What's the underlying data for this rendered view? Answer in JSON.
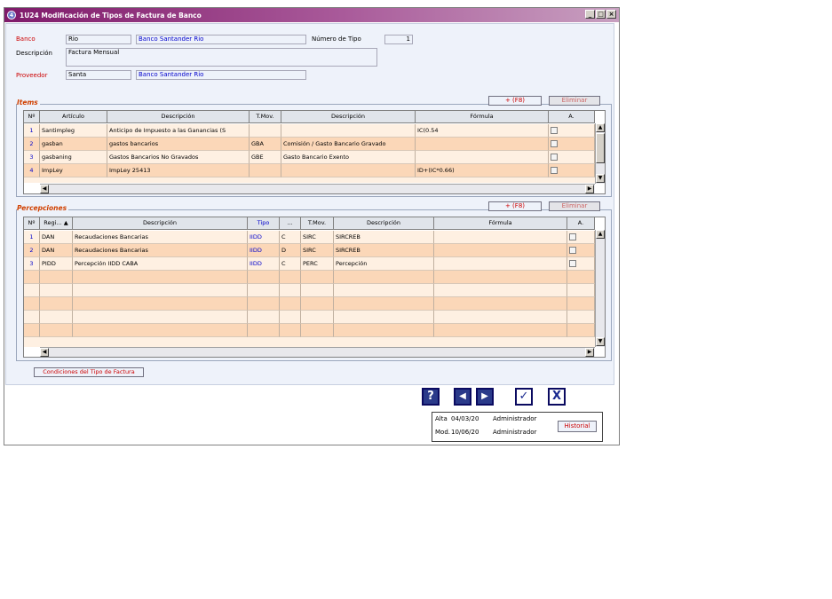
{
  "window": {
    "icon_text": "4",
    "title": "1U24   Modificación de Tipos de Factura de Banco",
    "btn_min": "_",
    "btn_max": "□",
    "btn_close": "×"
  },
  "form": {
    "banco_label": "Banco",
    "banco_code": "Rio",
    "banco_name": "Banco Santander Rio",
    "numero_tipo_label": "Número de Tipo",
    "numero_tipo_value": "1",
    "descripcion_label": "Descripción",
    "descripcion_value": "Factura Mensual",
    "proveedor_label": "Proveedor",
    "proveedor_code": "Santa",
    "proveedor_name": "Banco Santander Rio"
  },
  "items": {
    "section_title": "Items",
    "add_button": "+ (F8)",
    "delete_button": "Eliminar",
    "columns": [
      "Nº",
      "Artículo",
      "Descripción",
      "T.Mov.",
      "Descripción",
      "Fórmula",
      "A."
    ],
    "rows": [
      {
        "n": "1",
        "articulo": "Santimpleg",
        "descripcion": "Anticipo de Impuesto a las Ganancias (S",
        "tmov": "",
        "descripcion2": "",
        "formula": "IC(0.54",
        "checked": false
      },
      {
        "n": "2",
        "articulo": "gasban",
        "descripcion": "gastos bancarios",
        "tmov": "GBA",
        "descripcion2": "Comisión / Gasto Bancario Gravado",
        "formula": "",
        "checked": false
      },
      {
        "n": "3",
        "articulo": "gasbaning",
        "descripcion": "Gastos Bancarios No Gravados",
        "tmov": "GBE",
        "descripcion2": "Gasto Bancario Exento",
        "formula": "",
        "checked": false
      },
      {
        "n": "4",
        "articulo": "ImpLey",
        "descripcion": "ImpLey 25413",
        "tmov": "",
        "descripcion2": "",
        "formula": "ID+(IC*0.66)",
        "checked": false
      }
    ]
  },
  "percepciones": {
    "section_title": "Percepciones",
    "add_button": "+ (F8)",
    "delete_button": "Eliminar",
    "columns": [
      "Nº",
      "Regi... ▲",
      "Descripción",
      "Tipo",
      "...",
      "T.Mov.",
      "Descripción",
      "Fórmula",
      "A."
    ],
    "rows": [
      {
        "n": "1",
        "regi": "DAN",
        "descripcion": "Recaudaciones Bancarias",
        "tipo": "IIDD",
        "c": "C",
        "tmov": "SIRC",
        "descripcion2": "SIRCREB",
        "formula": "",
        "checked": false
      },
      {
        "n": "2",
        "regi": "DAN",
        "descripcion": "Recaudaciones Bancarias",
        "tipo": "IIDD",
        "c": "D",
        "tmov": "SIRC",
        "descripcion2": "SIRCREB",
        "formula": "",
        "checked": false
      },
      {
        "n": "3",
        "regi": "PIDD",
        "descripcion": "Percepción IIDD CABA",
        "tipo": "IIDD",
        "c": "C",
        "tmov": "PERC",
        "descripcion2": "Percepción",
        "formula": "",
        "checked": false
      }
    ]
  },
  "footer": {
    "link_button": "Condiciones del Tipo de Factura",
    "help": "?",
    "prev": "◀",
    "next": "▶",
    "confirm": "✓",
    "cancel": "X",
    "audit_alta_label": "Alta",
    "audit_alta_date": "04/03/20",
    "audit_alta_user": "Administrador",
    "audit_mod_label": "Mod.",
    "audit_mod_date": "10/06/20",
    "audit_mod_user": "Administrador",
    "historial_button": "Historial"
  }
}
